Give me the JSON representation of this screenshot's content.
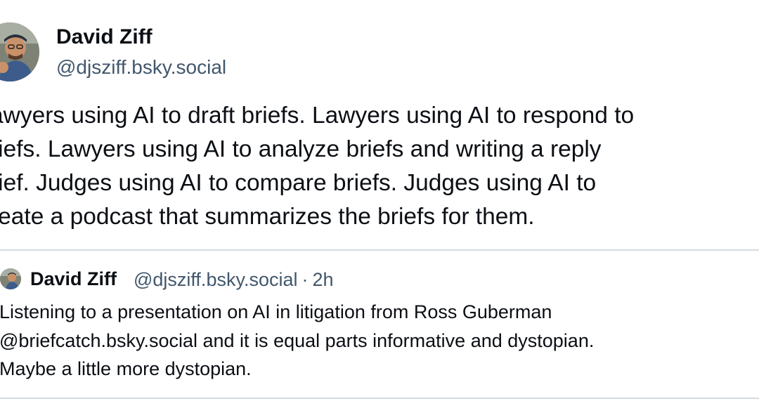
{
  "post": {
    "author": {
      "name": "David Ziff",
      "handle": "@djsziff.bsky.social",
      "avatar": "avatar-photo"
    },
    "text": "awyers using AI to draft briefs. Lawyers using AI to respond to\nriefs. Lawyers using AI to analyze briefs and writing a reply\nrief. Judges using AI to compare briefs. Judges using AI to\nreate a podcast that summarizes the briefs for them."
  },
  "quoted_post": {
    "author": {
      "name": "David Ziff",
      "handle": "@djsziff.bsky.social",
      "avatar": "avatar-photo"
    },
    "separator": "·",
    "timestamp": "2h",
    "text": "Listening to a presentation on AI in litigation from Ross Guberman\n@briefcatch.bsky.social and it is equal parts informative and dystopian.\nMaybe a little more dystopian."
  },
  "colors": {
    "text_primary": "#0b0f14",
    "text_secondary": "#42576c",
    "divider": "#d4dbe2",
    "background": "#ffffff"
  }
}
